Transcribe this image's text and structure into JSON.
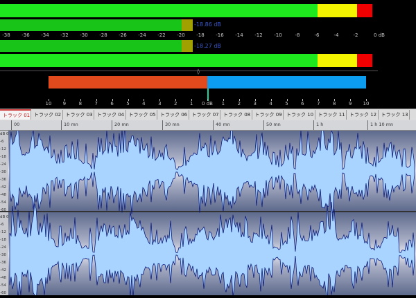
{
  "meter": {
    "top_scale": [
      "-38",
      "-36",
      "-34",
      "-32",
      "-30",
      "-28",
      "-26",
      "-24",
      "-22",
      "-20",
      "-18",
      "-16",
      "-14",
      "-12",
      "-10",
      "-8",
      "-6",
      "-4",
      "-2",
      "0 dB"
    ],
    "left_peak": "-18.86 dB",
    "right_peak": "-18.27 dB",
    "left_level_db": -18.86,
    "right_level_db": -18.27,
    "balance_scale": [
      "10",
      "9",
      "8",
      "7",
      "6",
      "5",
      "4",
      "3",
      "2",
      "1",
      "0 dB",
      "1",
      "2",
      "3",
      "4",
      "5",
      "6",
      "7",
      "8",
      "9",
      "10"
    ],
    "colors": {
      "green": "#1ee81e",
      "yellow": "#f4f400",
      "red": "#f00000",
      "hold": "#a0a000",
      "balance_left": "#e04a1c",
      "balance_right": "#0d9df0"
    }
  },
  "tabs": [
    {
      "label": "トラック 01 ×",
      "active": true
    },
    {
      "label": "トラック 02"
    },
    {
      "label": "トラック 03"
    },
    {
      "label": "トラック 04"
    },
    {
      "label": "トラック 05"
    },
    {
      "label": "トラック 06"
    },
    {
      "label": "トラック 07"
    },
    {
      "label": "トラック 08"
    },
    {
      "label": "トラック 09"
    },
    {
      "label": "トラック 10"
    },
    {
      "label": "トラック 11"
    },
    {
      "label": "トラック 12"
    },
    {
      "label": "トラック 13"
    }
  ],
  "ruler": [
    "00",
    "10 mn",
    "20 mn",
    "30 mn",
    "40 mn",
    "50 mn",
    "1 h",
    "1 h 10 mn"
  ],
  "db_labels_top": [
    "dB 0",
    "-6",
    "-12",
    "-18",
    "-24",
    "-30",
    "-36",
    "-42",
    "-48",
    "-54",
    "-60"
  ],
  "db_labels_bottom": [
    "dB 0",
    "-6",
    "-12",
    "-18",
    "-24",
    "-30",
    "-36",
    "-42",
    "-48",
    "-54",
    "-60"
  ]
}
